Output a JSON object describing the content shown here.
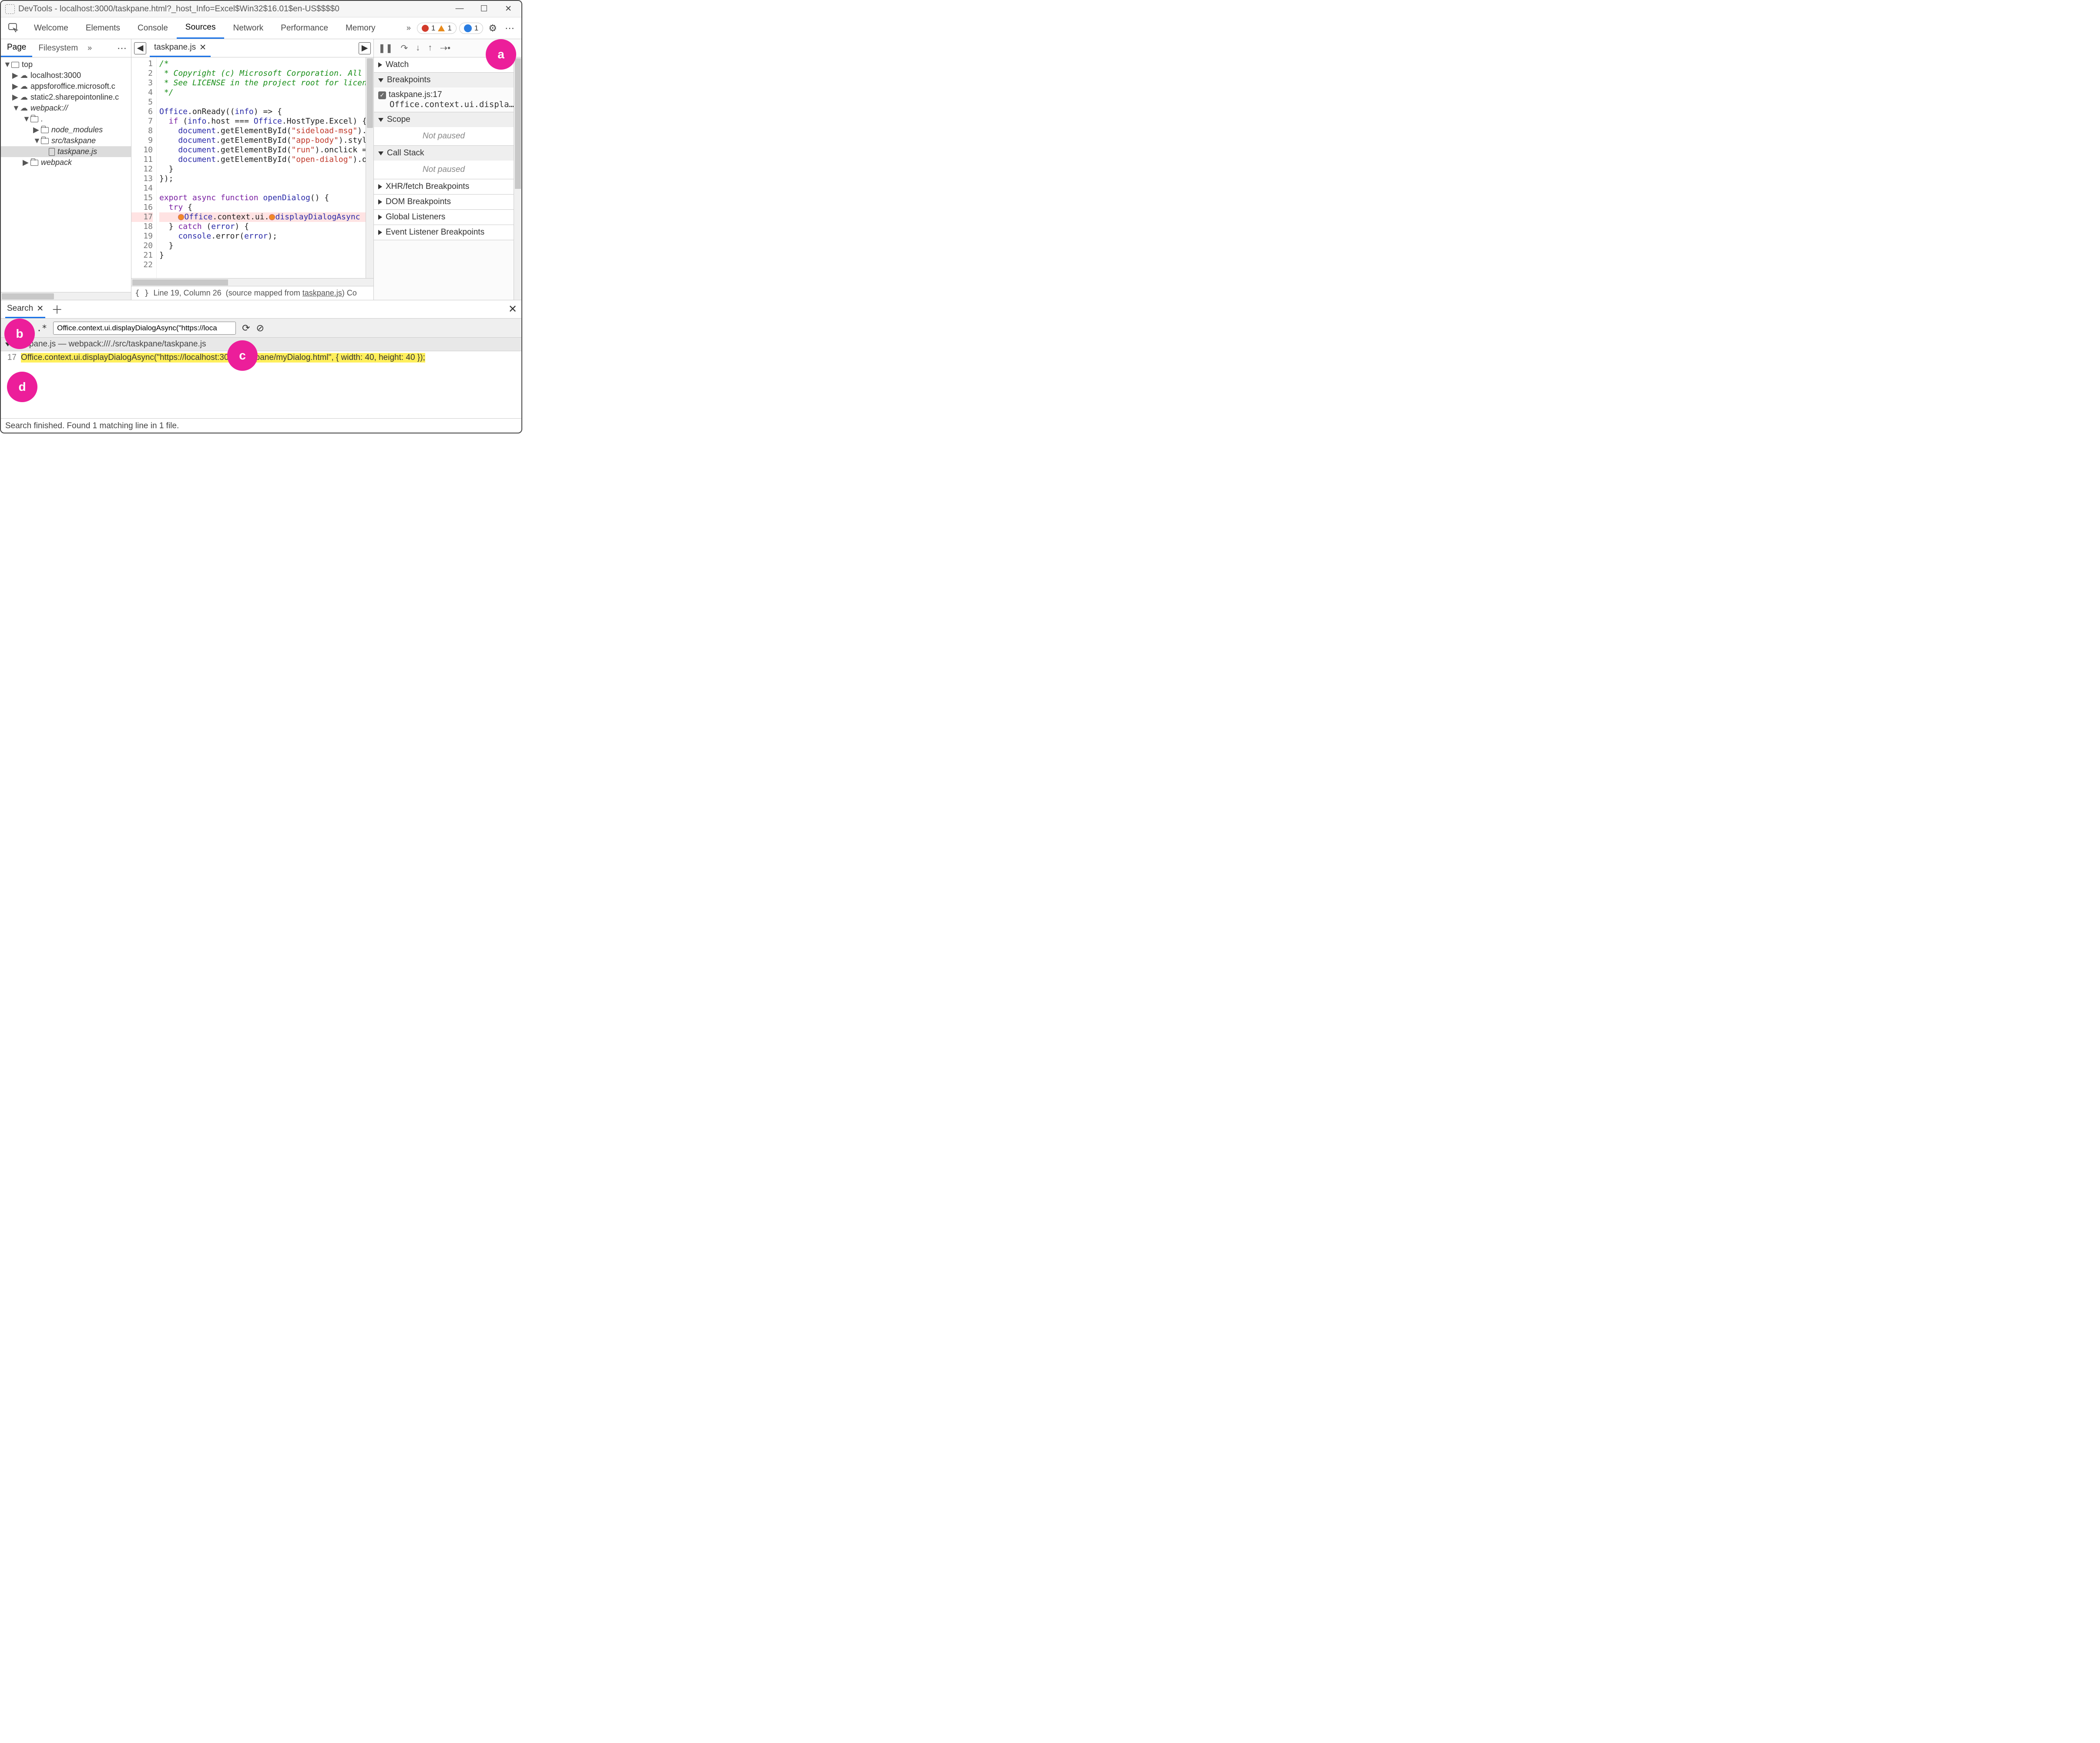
{
  "window": {
    "title": "DevTools - localhost:3000/taskpane.html?_host_Info=Excel$Win32$16.01$en-US$$$$0"
  },
  "tabs": {
    "items": [
      "Welcome",
      "Elements",
      "Console",
      "Sources",
      "Network",
      "Performance",
      "Memory"
    ],
    "active": "Sources"
  },
  "counters": {
    "errors": "1",
    "warnings": "1",
    "info": "1"
  },
  "sidebar": {
    "tabs": [
      "Page",
      "Filesystem"
    ],
    "active": "Page",
    "tree": {
      "top": "top",
      "domains": [
        "localhost:3000",
        "appsforoffice.microsoft.c",
        "static2.sharepointonline.c"
      ],
      "webpack": "webpack://",
      "dot": ".",
      "node_modules": "node_modules",
      "src_taskpane": "src/taskpane",
      "file": "taskpane.js",
      "webpack_folder": "webpack"
    }
  },
  "editor": {
    "tab": "taskpane.js",
    "lines": {
      "l1": "/*",
      "l2": " * Copyright (c) Microsoft Corporation. All ",
      "l3": " * See LICENSE in the project root for licen",
      "l4": " */",
      "l5": "",
      "l6a": "Office",
      "l6b": ".onReady((",
      "l6c": "info",
      "l6d": ") => {",
      "l7a": "  if",
      "l7b": " (",
      "l7c": "info",
      "l7d": ".host === ",
      "l7e": "Office",
      "l7f": ".HostType.Excel) {",
      "l8a": "    document",
      "l8b": ".getElementById(",
      "l8c": "\"sideload-msg\"",
      "l8d": ").",
      "l9a": "    document",
      "l9b": ".getElementById(",
      "l9c": "\"app-body\"",
      "l9d": ").styl",
      "l10a": "    document",
      "l10b": ".getElementById(",
      "l10c": "\"run\"",
      "l10d": ").onclick = ",
      "l11a": "    document",
      "l11b": ".getElementById(",
      "l11c": "\"open-dialog\"",
      "l11d": ").o",
      "l12": "  }",
      "l13": "});",
      "l14": "",
      "l15a": "export async function ",
      "l15b": "openDialog",
      "l15c": "() {",
      "l16a": "  try",
      "l16b": " {",
      "l17a": "Office",
      "l17b": ".context.ui.",
      "l17c": "displayDialogAsync",
      "l18a": "  } ",
      "l18b": "catch",
      "l18c": " (",
      "l18d": "error",
      "l18e": ") {",
      "l19a": "    console",
      "l19b": ".error(",
      "l19c": "error",
      "l19d": ");",
      "l20": "  }",
      "l21": "}",
      "l22": ""
    },
    "status": {
      "pos": "Line 19, Column 26",
      "mapped_prefix": "(source mapped from ",
      "mapped_file": "taskpane.js",
      "mapped_suffix": ")  Co"
    }
  },
  "debug": {
    "watch": "Watch",
    "breakpoints": "Breakpoints",
    "bp_file": "taskpane.js:17",
    "bp_code": "Office.context.ui.displa…",
    "scope": "Scope",
    "not_paused": "Not paused",
    "callstack": "Call Stack",
    "xhr": "XHR/fetch Breakpoints",
    "dom": "DOM Breakpoints",
    "global": "Global Listeners",
    "event": "Event Listener Breakpoints"
  },
  "drawer": {
    "tab": "Search",
    "regex_label": ".*",
    "query": "Office.context.ui.displayDialogAsync(\"https://loca",
    "result_header": "taskpane.js — webpack:///./src/taskpane/taskpane.js",
    "result_line_no": "17",
    "result_line": "Office.context.ui.displayDialogAsync(\"https://localhost:3000/taskpane/myDialog.html\", { width: 40, height: 40 });",
    "status": "Search finished.  Found 1 matching line in 1 file."
  },
  "markers": {
    "a": "a",
    "b": "b",
    "c": "c",
    "d": "d"
  }
}
